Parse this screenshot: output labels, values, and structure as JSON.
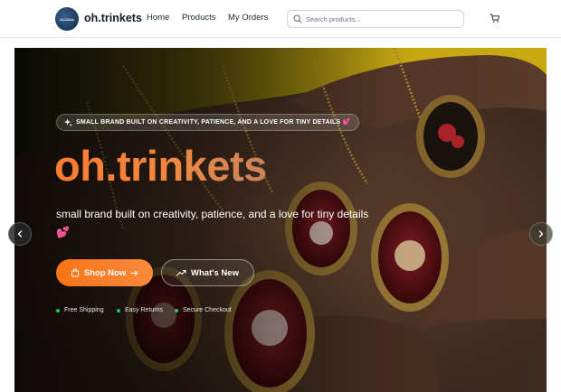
{
  "header": {
    "logo_text": "oh.trinkets",
    "brand": "oh.trinkets",
    "nav": [
      "Home",
      "Products",
      "My Orders"
    ],
    "search_placeholder": "Search products...",
    "icons": {
      "search": "search-icon",
      "cart": "cart-icon"
    }
  },
  "hero": {
    "badge": "SMALL BRAND BUILT ON CREATIVITY, PATIENCE, AND A LOVE FOR TINY DETAILS 💕",
    "title": "oh.trinkets",
    "subtitle": "small brand built on creativity, patience, and a love for tiny details 💕",
    "buttons": {
      "shop_now": "Shop Now",
      "whats_new": "What's New"
    },
    "features": [
      "Free Shipping",
      "Easy Returns",
      "Secure Checkout"
    ],
    "accent_color": "#f97316",
    "feature_dot_color": "#22c55e",
    "photo": "hand holding resin pendants with pressed red flowers on yellow background"
  },
  "carousel": {
    "prev_icon": "chevron-left-icon",
    "next_icon": "chevron-right-icon"
  }
}
